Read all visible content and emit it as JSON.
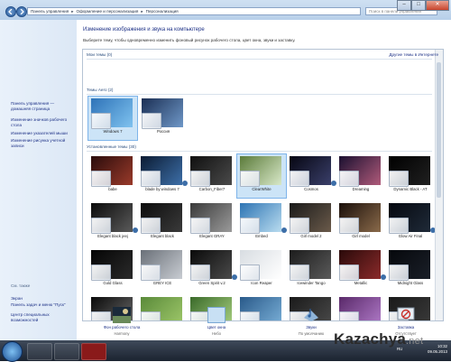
{
  "window": {
    "breadcrumb": [
      "Панель управления",
      "Оформление и персонализация",
      "Персонализация"
    ],
    "search_placeholder": "Поиск в панели управления",
    "controls": {
      "minimize": "–",
      "maximize": "□",
      "close": "✕"
    }
  },
  "sidebar": {
    "top_links": [
      "Панель управления — домашняя страница",
      "Изменение значков рабочего стола",
      "Изменение указателей мыши",
      "Изменение рисунка учетной записи"
    ],
    "see_also_title": "См. также",
    "bottom_links": [
      "Экран",
      "Панель задач и меню \"Пуск\"",
      "Центр специальных возможностей"
    ]
  },
  "main": {
    "title": "Изменение изображения и звука на компьютере",
    "subtitle": "Выберите тему, чтобы одновременно изменить фоновый рисунок рабочего стола, цвет окна, звуки и заставку.",
    "my_themes": "Мои темы (0)",
    "get_more": "Другие темы в Интернете",
    "aero_themes": "Темы Aero (2)",
    "aero_items": [
      {
        "label": "Windows 7",
        "colors": [
          "#2e73b8",
          "#7fc2ef"
        ],
        "selected": true
      },
      {
        "label": "Россия",
        "colors": [
          "#1b2f54",
          "#6f98c8"
        ],
        "selected": false
      }
    ],
    "installed_themes": "Установленные темы (30)",
    "installed_items": [
      {
        "label": "babe",
        "colors": [
          "#2a0c0c",
          "#9a3a2a"
        ]
      },
      {
        "label": "blade by windows 7",
        "colors": [
          "#0b1b33",
          "#3d6fa8"
        ]
      },
      {
        "label": "Carbon_Fiber7",
        "colors": [
          "#101010",
          "#4a4a4a"
        ]
      },
      {
        "label": "ClearWhite",
        "colors": [
          "#5b7b3a",
          "#d8e8c8"
        ],
        "selected": true
      },
      {
        "label": "Cosmos",
        "colors": [
          "#060612",
          "#3a3f6a"
        ]
      },
      {
        "label": "Dreaming",
        "colors": [
          "#1a1030",
          "#b05a7a"
        ]
      },
      {
        "label": "Dynamic Black - AT",
        "colors": [
          "#000000",
          "#202020"
        ]
      },
      {
        "label": "Elegant black jeej",
        "colors": [
          "#0a0a0a",
          "#5a5a5a"
        ]
      },
      {
        "label": "Elegant black",
        "colors": [
          "#0c0c0c",
          "#3a3a3a"
        ]
      },
      {
        "label": "Elegant GRAY",
        "colors": [
          "#3a3a3a",
          "#9a9a9a"
        ]
      },
      {
        "label": "Embed",
        "colors": [
          "#2d74b4",
          "#b9dcef"
        ]
      },
      {
        "label": "Girl model 2",
        "colors": [
          "#1a1a1a",
          "#6a5a4a"
        ]
      },
      {
        "label": "Girl model",
        "colors": [
          "#1a0f0a",
          "#8a6a4a"
        ]
      },
      {
        "label": "Glow Air Final",
        "colors": [
          "#05080f",
          "#1f2a38"
        ]
      },
      {
        "label": "Gold Glass",
        "colors": [
          "#050505",
          "#2a2a2a"
        ]
      },
      {
        "label": "GREY ICE",
        "colors": [
          "#6a7078",
          "#c8ccd2"
        ]
      },
      {
        "label": "Green Spirit v.2",
        "colors": [
          "#0a0a0a",
          "#4a4a4a"
        ]
      },
      {
        "label": "Icon Reaper",
        "colors": [
          "#d8dde2",
          "#ffffff"
        ]
      },
      {
        "label": "Icewinder Tango",
        "colors": [
          "#1c1c1c",
          "#5a5a5a"
        ]
      },
      {
        "label": "Metallic",
        "colors": [
          "#2a0a0a",
          "#8a2a2a"
        ]
      },
      {
        "label": "Midnight Glass",
        "colors": [
          "#06080c",
          "#1a1f28"
        ]
      },
      {
        "label": "",
        "colors": [
          "#0a0a0a",
          "#6a6a6a"
        ]
      },
      {
        "label": "",
        "colors": [
          "#5a8a3a",
          "#9fc86a"
        ]
      },
      {
        "label": "",
        "colors": [
          "#3a6a2a",
          "#a8d080"
        ]
      },
      {
        "label": "",
        "colors": [
          "#2a5a8a",
          "#7ab0d8"
        ]
      },
      {
        "label": "",
        "colors": [
          "#1a1a1a",
          "#4a4a4a"
        ]
      },
      {
        "label": "",
        "colors": [
          "#5a2a6a",
          "#b07ac8"
        ]
      },
      {
        "label": "",
        "colors": [
          "#1a1a1a",
          "#3a3a3a"
        ]
      }
    ]
  },
  "bottom": {
    "items": [
      {
        "title": "Фон рабочего стола",
        "value": "Harmony"
      },
      {
        "title": "Цвет окна",
        "value": "Небо"
      },
      {
        "title": "Звуки",
        "value": "По умолчанию"
      },
      {
        "title": "Заставка",
        "value": "Отсутствует"
      }
    ]
  },
  "taskbar": {
    "lang": "RU",
    "time": "10:32",
    "date": "09.05.2013"
  },
  "watermark": {
    "main": "Kazachya",
    "suffix": ".net"
  },
  "colors": {
    "link": "#1e3287",
    "accent": "#2d5f9e",
    "selected": "#cce4f7"
  }
}
